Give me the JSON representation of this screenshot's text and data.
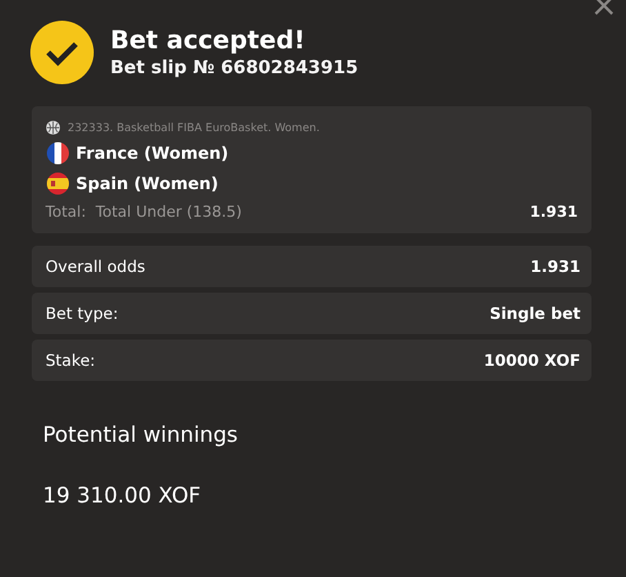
{
  "header": {
    "title": "Bet accepted!",
    "subtitle": "Bet slip № 66802843915"
  },
  "event": {
    "league": "232333. Basketball FIBA EuroBasket. Women.",
    "teams": [
      {
        "name": "France (Women)",
        "kind": "france"
      },
      {
        "name": "Spain (Women)",
        "kind": "spain"
      }
    ],
    "market_label": "Total:",
    "market": "Total Under (138.5)",
    "odds": "1.931"
  },
  "summary": [
    {
      "label": "Overall odds",
      "value": "1.931"
    },
    {
      "label": "Bet type:",
      "value": "Single bet"
    },
    {
      "label": "Stake:",
      "value": "10000 XOF"
    }
  ],
  "winnings": {
    "label": "Potential winnings",
    "amount": "19 310.00 XOF"
  }
}
